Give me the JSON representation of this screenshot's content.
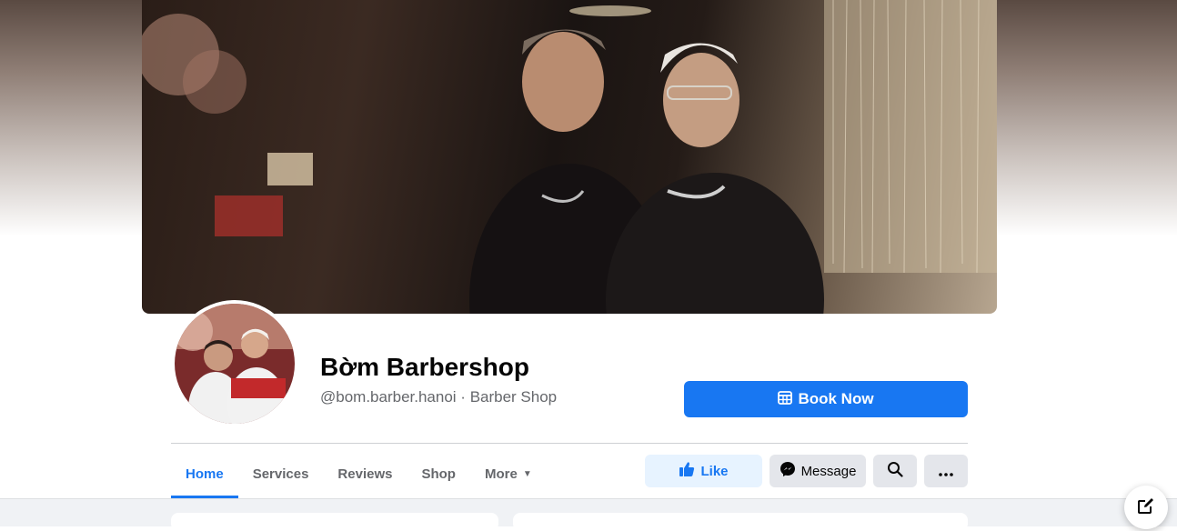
{
  "page": {
    "name": "Bờm Barbershop",
    "handle": "@bom.barber.hanoi",
    "separator": " · ",
    "category": "Barber Shop"
  },
  "cta": {
    "book_label": "Book Now"
  },
  "tabs": [
    {
      "label": "Home",
      "active": true
    },
    {
      "label": "Services"
    },
    {
      "label": "Reviews"
    },
    {
      "label": "Shop"
    },
    {
      "label": "More"
    }
  ],
  "actions": {
    "like_label": "Like",
    "message_label": "Message"
  },
  "icons": {
    "calendar": "calendar-icon",
    "thumbs_up": "thumbs-up-icon",
    "messenger": "messenger-icon",
    "search": "search-icon",
    "more": "more-icon",
    "compose": "compose-icon",
    "caret": "caret-down-icon"
  },
  "colors": {
    "brand": "#1877f2",
    "like_bg": "#e7f3ff",
    "button_gray": "#e4e6eb",
    "text_primary": "#050505",
    "text_secondary": "#65676b"
  }
}
